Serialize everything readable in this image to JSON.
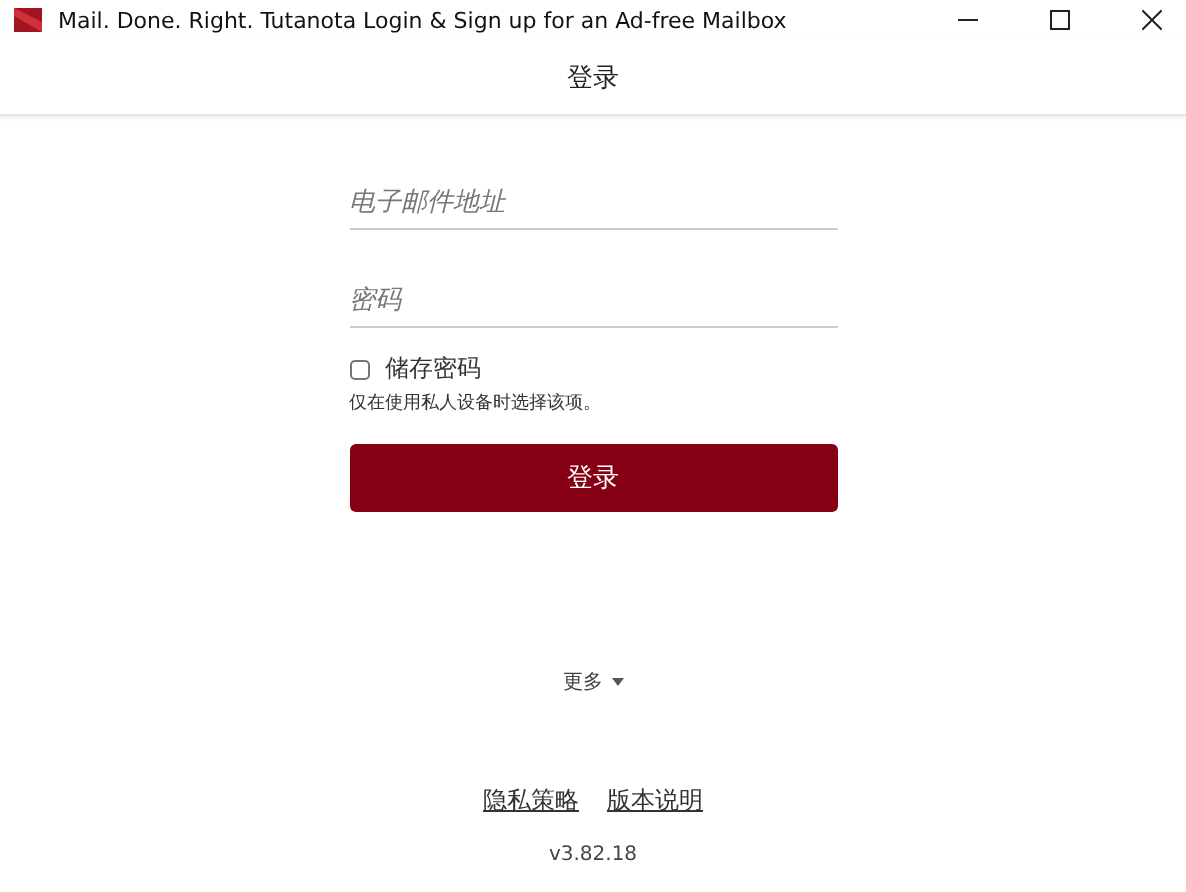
{
  "window": {
    "title": "Mail. Done. Right. Tutanota Login & Sign up for an Ad-free Mailbox"
  },
  "header": {
    "title": "登录"
  },
  "form": {
    "email": {
      "placeholder": "电子邮件地址"
    },
    "password": {
      "placeholder": "密码"
    },
    "remember": {
      "label": "储存密码",
      "checked": false,
      "hint": "仅在使用私人设备时选择该项。"
    },
    "submit": "登录"
  },
  "more": {
    "label": "更多",
    "expanded": false
  },
  "footer": {
    "links": [
      "隐私策略",
      "版本说明"
    ],
    "version": "v3.82.18"
  }
}
